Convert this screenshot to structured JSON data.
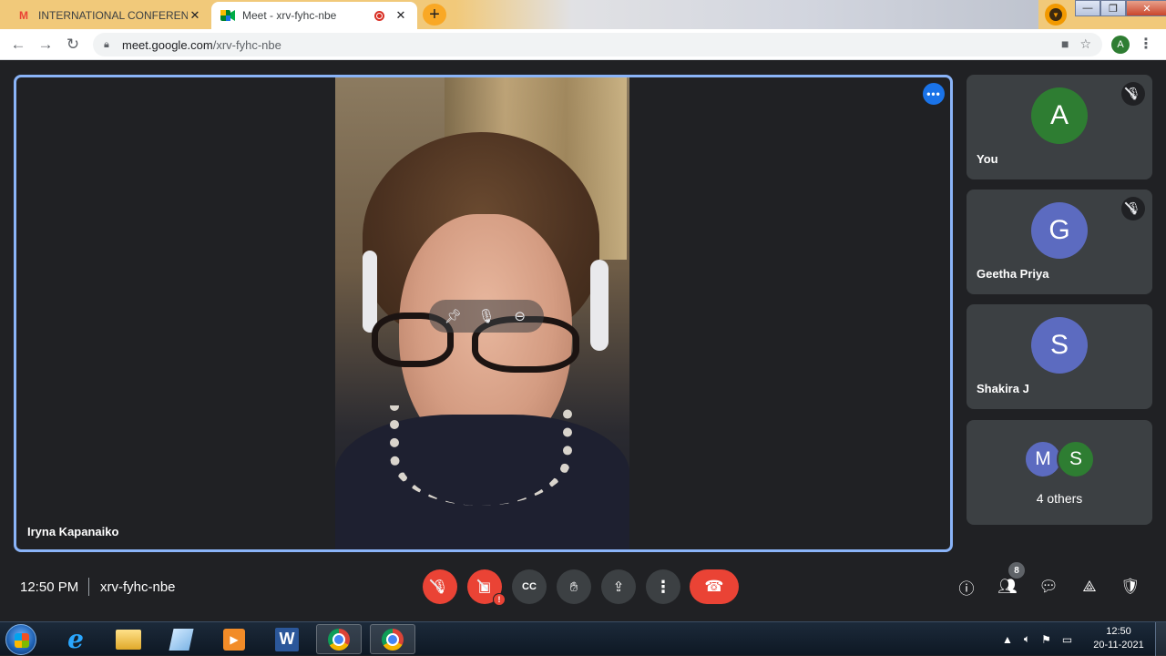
{
  "browser": {
    "tabs": [
      {
        "title": "INTERNATIONAL CONFERENCE C",
        "favicon": "gmail-icon",
        "active": false
      },
      {
        "title": "Meet - xrv-fyhc-nbe",
        "favicon": "meet-icon",
        "active": true
      }
    ],
    "url_host": "meet.google.com",
    "url_path": "/xrv-fyhc-nbe",
    "profile_initial": "A"
  },
  "stage": {
    "name": "Iryna Kapanaiko",
    "more_glyph": "•••"
  },
  "participants": [
    {
      "name": "You",
      "initial": "A",
      "color": "#2e7d32",
      "muted": true
    },
    {
      "name": "Geetha Priya",
      "initial": "G",
      "color": "#5c6bc0",
      "muted": true
    },
    {
      "name": "Shakira J",
      "initial": "S",
      "color": "#5c6bc0",
      "muted": false
    }
  ],
  "others": {
    "label": "4 others",
    "avatars": [
      {
        "initial": "M",
        "color": "#5c6bc0"
      },
      {
        "initial": "S",
        "color": "#2e7d32"
      }
    ]
  },
  "meetbar": {
    "time": "12:50 PM",
    "code": "xrv-fyhc-nbe",
    "people_count": "8",
    "end_color": "#ea4335"
  },
  "taskbar": {
    "time": "12:50",
    "date": "20-11-2021"
  },
  "colors": {
    "accent": "#8ab4f8",
    "meet_bg": "#202124",
    "tile_bg": "#3c4043",
    "danger": "#ea4335"
  }
}
